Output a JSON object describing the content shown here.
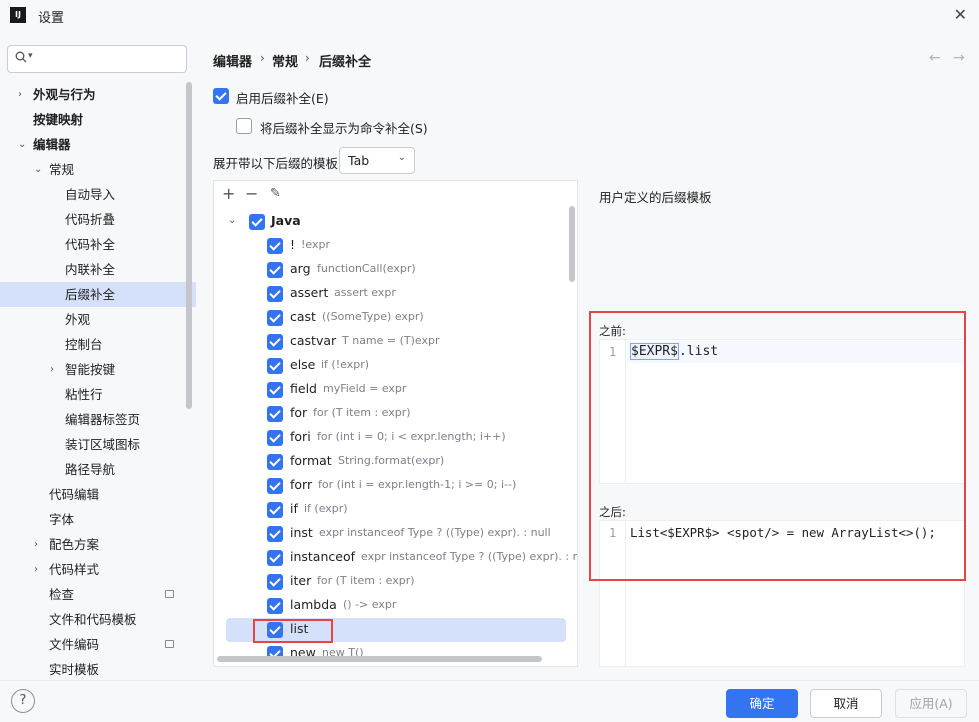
{
  "window": {
    "app_icon": "IJ",
    "title": "设置",
    "close": "✕"
  },
  "sidebar": {
    "search_placeholder": "",
    "items": [
      {
        "label": "外观与行为",
        "indent": 0,
        "chevron": "›",
        "bold": true
      },
      {
        "label": "按键映射",
        "indent": 0,
        "chevron": "",
        "bold": true
      },
      {
        "label": "编辑器",
        "indent": 0,
        "chevron": "⌄",
        "bold": true
      },
      {
        "label": "常规",
        "indent": 1,
        "chevron": "⌄"
      },
      {
        "label": "自动导入",
        "indent": 2,
        "chevron": ""
      },
      {
        "label": "代码折叠",
        "indent": 2,
        "chevron": ""
      },
      {
        "label": "代码补全",
        "indent": 2,
        "chevron": ""
      },
      {
        "label": "内联补全",
        "indent": 2,
        "chevron": ""
      },
      {
        "label": "后缀补全",
        "indent": 2,
        "chevron": "",
        "selected": true
      },
      {
        "label": "外观",
        "indent": 2,
        "chevron": ""
      },
      {
        "label": "控制台",
        "indent": 2,
        "chevron": ""
      },
      {
        "label": "智能按键",
        "indent": 2,
        "chevron": "›"
      },
      {
        "label": "粘性行",
        "indent": 2,
        "chevron": ""
      },
      {
        "label": "编辑器标签页",
        "indent": 2,
        "chevron": ""
      },
      {
        "label": "装订区域图标",
        "indent": 2,
        "chevron": ""
      },
      {
        "label": "路径导航",
        "indent": 2,
        "chevron": ""
      },
      {
        "label": "代码编辑",
        "indent": 1,
        "chevron": ""
      },
      {
        "label": "字体",
        "indent": 1,
        "chevron": ""
      },
      {
        "label": "配色方案",
        "indent": 1,
        "chevron": "›"
      },
      {
        "label": "代码样式",
        "indent": 1,
        "chevron": "›"
      },
      {
        "label": "检查",
        "indent": 1,
        "chevron": "",
        "badge": true
      },
      {
        "label": "文件和代码模板",
        "indent": 1,
        "chevron": ""
      },
      {
        "label": "文件编码",
        "indent": 1,
        "chevron": "",
        "badge": true
      },
      {
        "label": "实时模板",
        "indent": 1,
        "chevron": ""
      }
    ]
  },
  "breadcrumb": {
    "items": [
      "编辑器",
      "常规",
      "后缀补全"
    ],
    "sep": "›",
    "back": "←",
    "forward": "→"
  },
  "options": {
    "enable_label": "启用后缀补全(E)",
    "show_as_command_label": "将后缀补全显示为命令补全(S)",
    "expand_label": "展开带以下后缀的模板",
    "expand_value": "Tab",
    "expand_arrow": "⌄"
  },
  "toolbar": {
    "add": "+",
    "remove": "−",
    "edit": "✎"
  },
  "templates": {
    "group": "Java",
    "group_chevron": "⌄",
    "rows": [
      {
        "key": "!",
        "desc": "!expr"
      },
      {
        "key": "arg",
        "desc": "functionCall(expr)"
      },
      {
        "key": "assert",
        "desc": "assert expr"
      },
      {
        "key": "cast",
        "desc": "((SomeType) expr)"
      },
      {
        "key": "castvar",
        "desc": "T name = (T)expr"
      },
      {
        "key": "else",
        "desc": "if (!expr)"
      },
      {
        "key": "field",
        "desc": "myField = expr"
      },
      {
        "key": "for",
        "desc": "for (T item : expr)"
      },
      {
        "key": "fori",
        "desc": "for (int i = 0; i < expr.length; i++)"
      },
      {
        "key": "format",
        "desc": "String.format(expr)"
      },
      {
        "key": "forr",
        "desc": "for (int i = expr.length-1; i >= 0; i--)"
      },
      {
        "key": "if",
        "desc": "if (expr)"
      },
      {
        "key": "inst",
        "desc": "expr instanceof Type ? ((Type) expr). : null"
      },
      {
        "key": "instanceof",
        "desc": "expr instanceof Type ? ((Type) expr). : null"
      },
      {
        "key": "iter",
        "desc": "for (T item : expr)"
      },
      {
        "key": "lambda",
        "desc": "() -> expr"
      },
      {
        "key": "list",
        "desc": "",
        "selected": true
      },
      {
        "key": "new",
        "desc": "new T()"
      }
    ]
  },
  "right": {
    "title": "用户定义的后缀模板",
    "before_label": "之前:",
    "before_line": "1",
    "before_highlight": "$EXPR$",
    "before_rest": ".list",
    "after_label": "之后:",
    "after_line": "1",
    "after_code": "List<$EXPR$> <spot/> = new ArrayList<>();"
  },
  "footer": {
    "help": "?",
    "ok": "确定",
    "cancel": "取消",
    "apply": "应用(A)"
  },
  "colors": {
    "accent": "#3574f0",
    "selection": "#d5e1fb",
    "annotation_red": "#e64545"
  }
}
